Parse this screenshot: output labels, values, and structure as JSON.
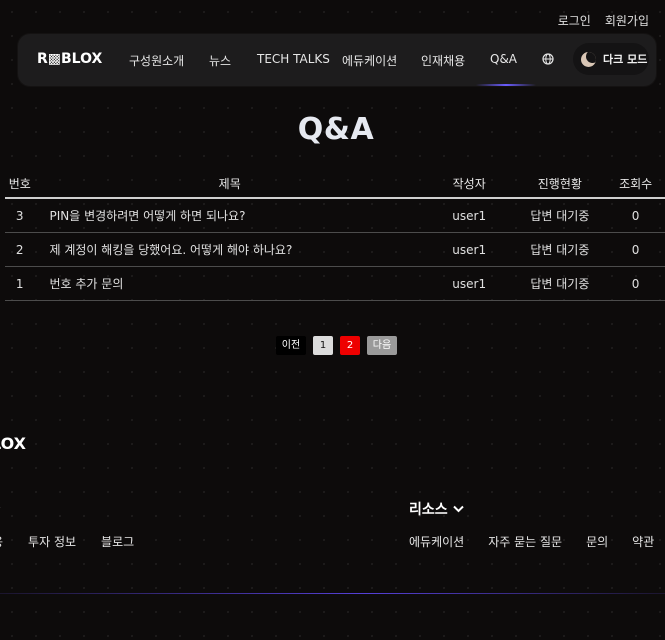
{
  "top_links": {
    "login": "로그인",
    "signup": "회원가입"
  },
  "nav": {
    "logo": "R▩BLOX",
    "items": [
      "구성원소개",
      "뉴스",
      "TECH TALKS",
      "에듀케이션",
      "인재채용",
      "Q&A"
    ],
    "globe_icon": "globe-icon",
    "dark_mode_label": "다크 모드",
    "accent": "#6a5cff"
  },
  "page_title": "Q&A",
  "table": {
    "headers": {
      "no": "번호",
      "title": "제목",
      "author": "작성자",
      "status": "진행현황",
      "views": "조회수"
    },
    "rows": [
      {
        "no": "3",
        "title": "PIN을 변경하려면 어떻게 하면 되나요?",
        "author": "user1",
        "status": "답변 대기중",
        "views": "0"
      },
      {
        "no": "2",
        "title": "제 계정이 해킹을 당했어요. 어떻게 해야 하나요?",
        "author": "user1",
        "status": "답변 대기중",
        "views": "0"
      },
      {
        "no": "1",
        "title": "번호 추가 문의",
        "author": "user1",
        "status": "답변 대기중",
        "views": "0"
      }
    ]
  },
  "pagination": {
    "prev": "이전",
    "pages": [
      "1",
      "2"
    ],
    "next": "다음",
    "active_color": "#ee0000"
  },
  "footer": {
    "logo": "LOX",
    "left_heading": "-",
    "left_links": [
      "용",
      "투자 정보",
      "블로그"
    ],
    "resources_heading": "리소스",
    "resources_links": [
      "에듀케이션",
      "자주 묻는 질문",
      "문의",
      "약관"
    ]
  }
}
